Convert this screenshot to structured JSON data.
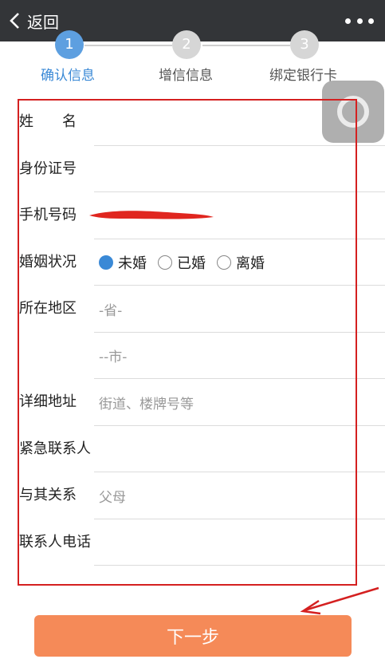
{
  "navbar": {
    "back_label": "返回"
  },
  "steps": [
    {
      "number": "1",
      "label": "确认信息",
      "active": true
    },
    {
      "number": "2",
      "label": "增信信息",
      "active": false
    },
    {
      "number": "3",
      "label": "绑定银行卡",
      "active": false
    }
  ],
  "form": {
    "name_label": "姓　　名",
    "id_label": "身份证号",
    "phone_label": "手机号码",
    "marital_label": "婚姻状况",
    "marital_options": [
      "未婚",
      "已婚",
      "离婚"
    ],
    "marital_selected": "未婚",
    "region_label": "所在地区",
    "province_placeholder": "-省-",
    "city_placeholder": "--市-",
    "address_label": "详细地址",
    "address_placeholder": "街道、楼牌号等",
    "emergency_label": "紧急联系人",
    "relation_label": "与其关系",
    "relation_placeholder": "父母",
    "contact_phone_label": "联系人电话"
  },
  "next_button_label": "下一步",
  "colors": {
    "accent": "#3a89d6",
    "next_button": "#f58a58",
    "annotation": "#d42020",
    "navbar": "#333538"
  }
}
